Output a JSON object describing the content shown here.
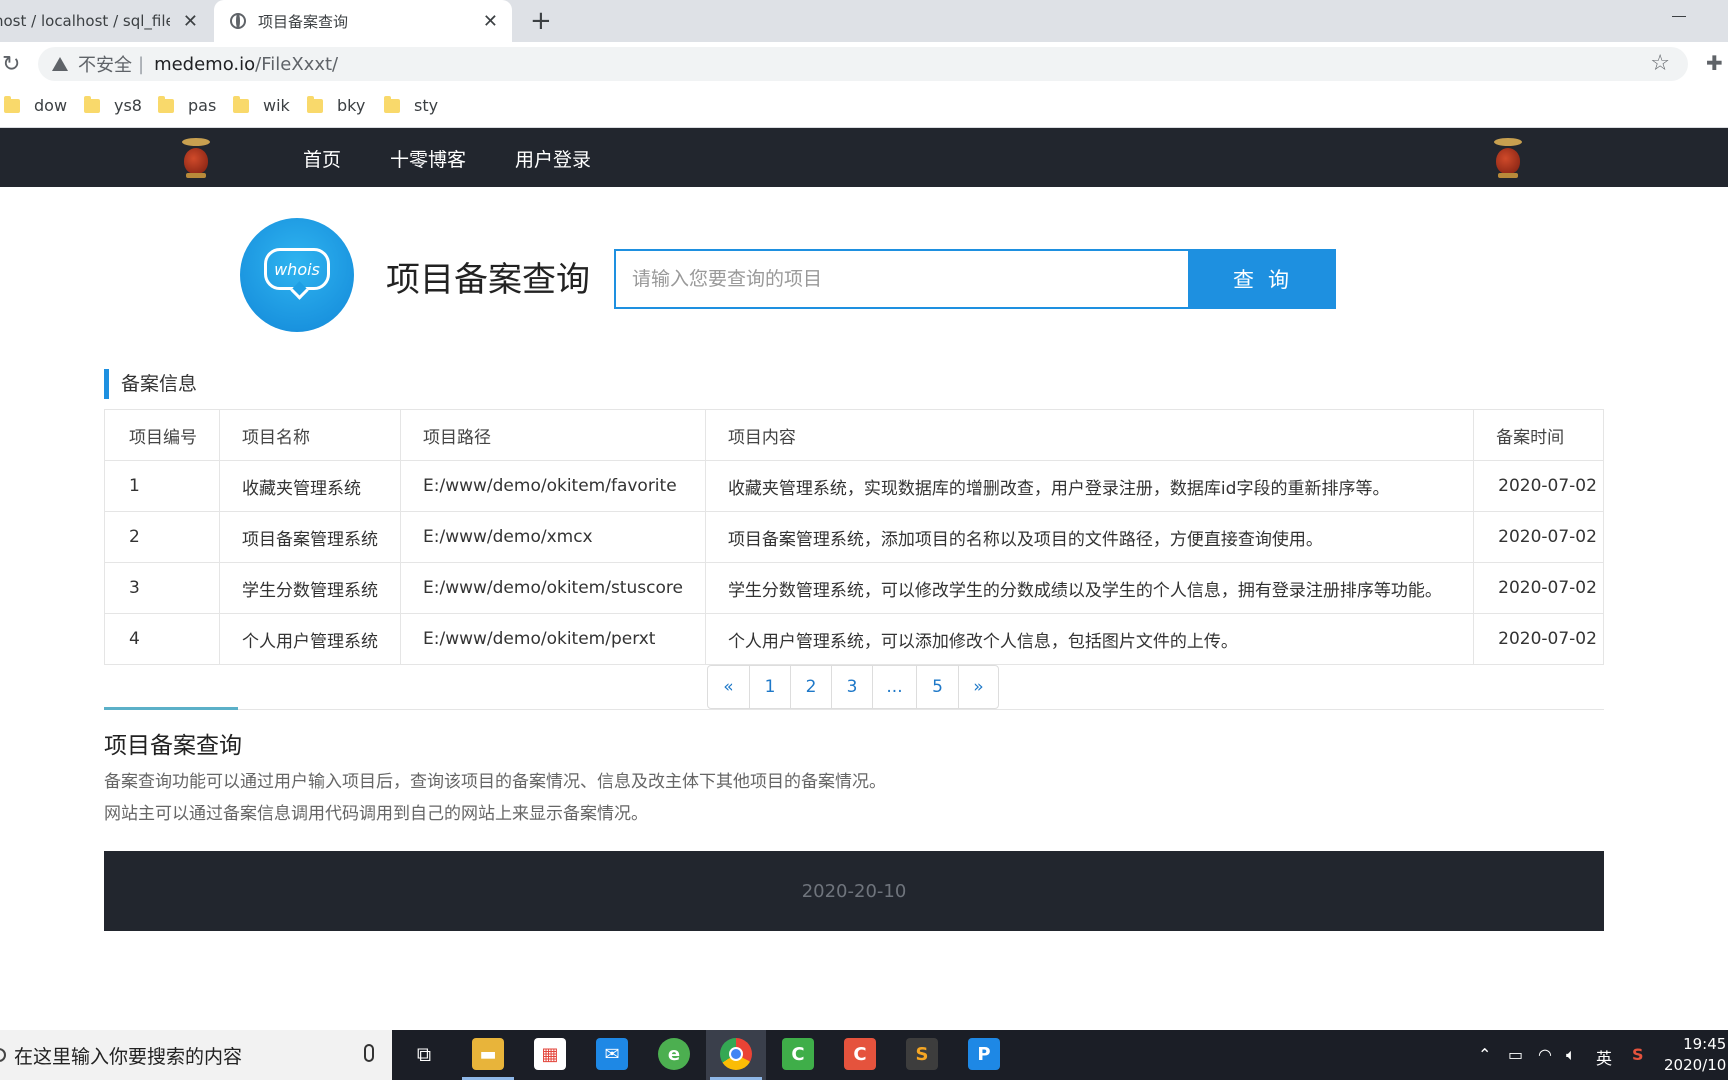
{
  "browser": {
    "tabs": [
      {
        "title": "host / localhost / sql_filex"
      },
      {
        "title": "项目备案查询"
      }
    ],
    "address": {
      "insecure_label": "不安全",
      "host": "medemo.io",
      "path": "/FileXxxt/"
    },
    "bookmarks": [
      "dow",
      "ys8",
      "pas",
      "wik",
      "bky",
      "sty"
    ]
  },
  "nav": {
    "items": [
      "首页",
      "十零博客",
      "用户登录"
    ]
  },
  "hero": {
    "logo_text": "whois",
    "title": "项目备案查询",
    "search_placeholder": "请输入您要查询的项目",
    "search_button": "查询"
  },
  "records": {
    "section_title": "备案信息",
    "columns": [
      "项目编号",
      "项目名称",
      "项目路径",
      "项目内容",
      "备案时间"
    ],
    "rows": [
      [
        "1",
        "收藏夹管理系统",
        "E:/www/demo/okitem/favorite",
        "收藏夹管理系统，实现数据库的增删改查，用户登录注册，数据库id字段的重新排序等。",
        "2020-07-02"
      ],
      [
        "2",
        "项目备案管理系统",
        "E:/www/demo/xmcx",
        "项目备案管理系统，添加项目的名称以及项目的文件路径，方便直接查询使用。",
        "2020-07-02"
      ],
      [
        "3",
        "学生分数管理系统",
        "E:/www/demo/okitem/stuscore",
        "学生分数管理系统，可以修改学生的分数成绩以及学生的个人信息，拥有登录注册排序等功能。",
        "2020-07-02"
      ],
      [
        "4",
        "个人用户管理系统",
        "E:/www/demo/okitem/perxt",
        "个人用户管理系统，可以添加修改个人信息，包括图片文件的上传。",
        "2020-07-02"
      ]
    ],
    "pagination": [
      "«",
      "1",
      "2",
      "3",
      "...",
      "5",
      "»"
    ]
  },
  "about": {
    "title": "项目备案查询",
    "lines": [
      "备案查询功能可以通过用户输入项目后，查询该项目的备案情况、信息及改主体下其他项目的备案情况。",
      "网站主可以通过备案信息调用代码调用到自己的网站上来显示备案情况。"
    ]
  },
  "footer": {
    "text": "2020-20-10"
  },
  "taskbar": {
    "search_placeholder": "在这里输入你要搜索的内容",
    "ime": "英",
    "time": "19:45",
    "date": "2020/10"
  },
  "colors": {
    "accent": "#1e90e0",
    "nav_bg": "#22262e",
    "link": "#1e78c8"
  }
}
